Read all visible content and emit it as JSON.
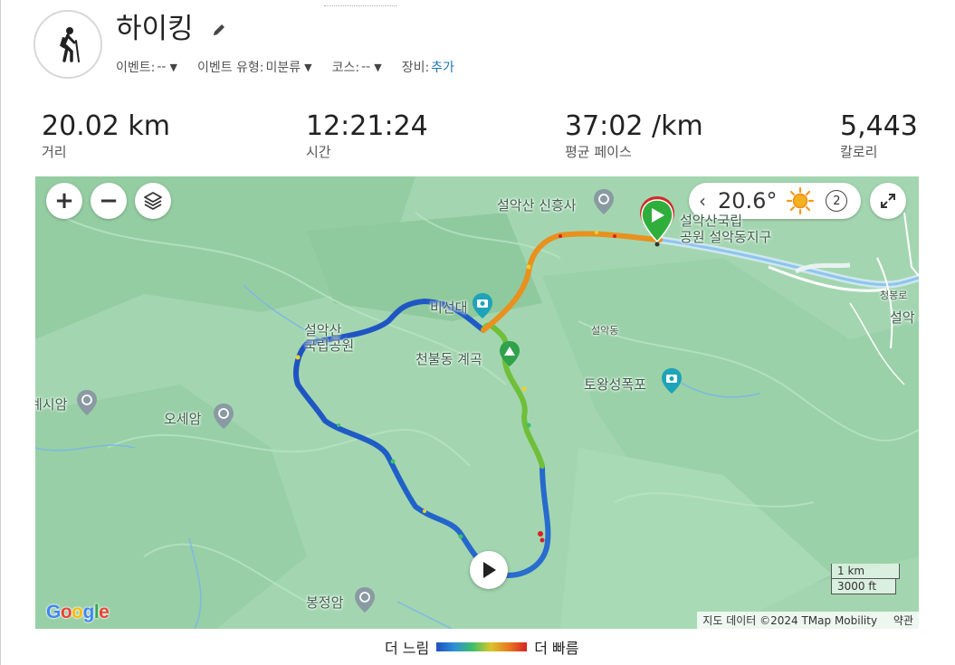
{
  "header": {
    "title": "하이킹",
    "activity_icon": "hiker-icon",
    "meta": [
      {
        "label": "이벤트:",
        "value": "--"
      },
      {
        "label": "이벤트 유형:",
        "value": "미분류"
      },
      {
        "label": "코스:",
        "value": "--"
      }
    ],
    "gear_label": "장비:",
    "gear_link": "추가"
  },
  "stats": [
    {
      "value": "20.02 km",
      "label": "거리"
    },
    {
      "value": "12:21:24",
      "label": "시간"
    },
    {
      "value": "37:02 /km",
      "label": "평균 페이스"
    },
    {
      "value": "5,443",
      "label": "칼로리"
    }
  ],
  "map": {
    "zoom_in": "+",
    "zoom_out": "−",
    "weather": {
      "temperature": "20.6°",
      "day": "2",
      "icon": "sun-icon"
    },
    "pois": {
      "sinheungsa": "설악산 신흥사",
      "park_line1": "설악산국립",
      "park_line2": "공원 설악동지구",
      "biseondae": "비선대",
      "seoraksa_line1": "설악산",
      "seoraksa_line2": "국립공원",
      "seorakdong": "설악동",
      "cheonbuldong": "천불동 계곡",
      "towangseong": "토왕성폭포",
      "gyesiam": "계시암",
      "osaeam": "오세암",
      "bongjeongam": "봉정암",
      "cheongbongro": "청봉로",
      "seorak_edge": "설악"
    },
    "scale": {
      "metric": "1 km",
      "imperial": "3000 ft"
    },
    "google": "Google",
    "attribution": "지도 데이터 ©2024 TMap Mobility",
    "terms": "약관"
  },
  "legend": {
    "slow": "더 느림",
    "fast": "더 빠름"
  },
  "colors": {
    "link": "#1a73b5",
    "map_bg": "#9fd3ad",
    "start_marker": "#2fae3b",
    "track_slow": "#1f4fbf",
    "track_fast": "#d62222"
  }
}
